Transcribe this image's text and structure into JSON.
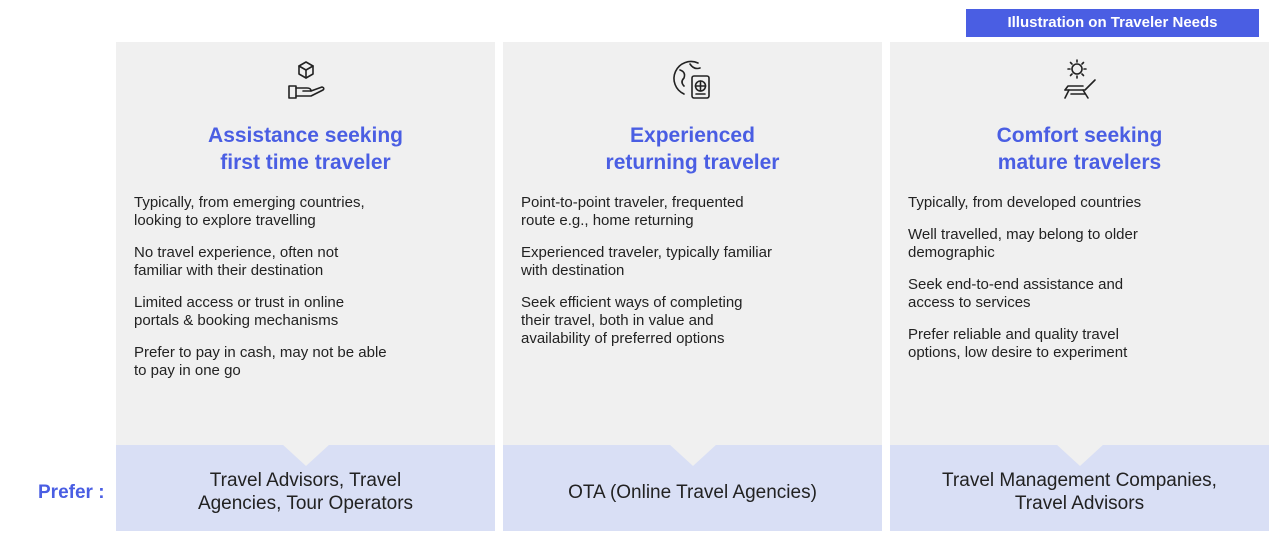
{
  "banner": "Illustration on Traveler Needs",
  "prefer_label": "Prefer :",
  "accent_color": "#4a5ee3",
  "card_bg": "#f0f0f0",
  "pref_bg": "#d9dff5",
  "columns": [
    {
      "icon": "hand-holding-box-icon",
      "title": "Assistance seeking\nfirst time traveler",
      "bullets": [
        "Typically, from emerging countries,\nlooking to explore travelling",
        "No travel experience, often not\nfamiliar with their destination",
        "Limited access or trust in online\nportals & booking mechanisms",
        "Prefer to pay in cash, may not be able\nto pay in one go"
      ],
      "prefer": "Travel Advisors, Travel\nAgencies, Tour Operators"
    },
    {
      "icon": "globe-passport-icon",
      "title": "Experienced\nreturning traveler",
      "bullets": [
        "Point-to-point traveler, frequented\nroute e.g., home returning",
        "Experienced traveler, typically familiar\nwith destination",
        "Seek efficient ways of completing\ntheir travel, both in value and\navailability of preferred options"
      ],
      "prefer": "OTA (Online Travel Agencies)"
    },
    {
      "icon": "sun-lounger-icon",
      "title": "Comfort seeking\nmature travelers",
      "bullets": [
        "Typically, from developed countries",
        "Well travelled, may belong to older\ndemographic",
        "Seek end-to-end assistance and\naccess to services",
        "Prefer reliable and quality travel\noptions, low desire to experiment"
      ],
      "prefer": "Travel Management Companies,\nTravel Advisors"
    }
  ]
}
